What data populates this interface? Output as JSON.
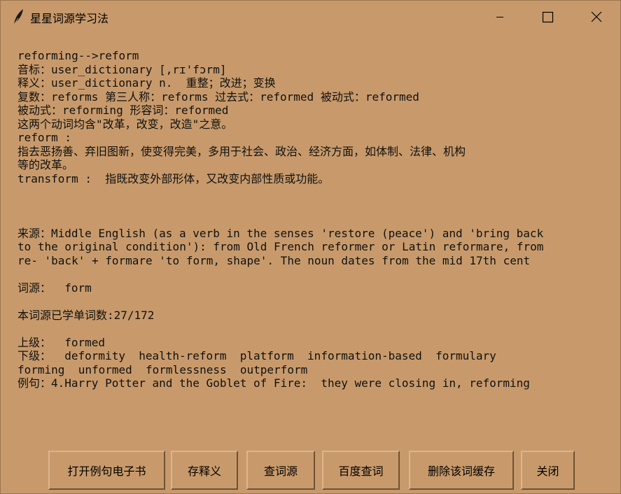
{
  "window": {
    "title": "星星词源学习法"
  },
  "content": {
    "lines": [
      "reforming-->reform",
      "音标：user_dictionary [,rɪ'fɔrm]",
      "释义：user_dictionary n.  重整；改进；变换",
      "复数：reforms 第三人称：reforms 过去式：reformed 被动式：reformed",
      "被动式：reforming 形容词：reformed",
      "这两个动词均含\"改革，改变，改造\"之意。",
      "reform :",
      "指去恶扬善、弃旧图新，使变得完美，多用于社会、政治、经济方面，如体制、法律、机构",
      "等的改革。",
      "transform :  指既改变外部形体，又改变内部性质或功能。",
      "",
      "",
      "",
      "来源：Middle English (as a verb in the senses 'restore (peace') and 'bring back",
      "to the original condition'): from Old French reformer or Latin reformare, from",
      "re- 'back' + formare 'to form, shape'. The noun dates from the mid 17th cent",
      "",
      "词源：  form",
      "",
      "本词源已学单词数:27/172",
      "",
      "上级：  formed",
      "下级：  deformity  health-reform  platform  information-based  formulary",
      "forming  unformed  formlessness  outperform",
      "例句：4.Harry Potter and the Goblet of Fire:  they were closing in, reforming"
    ]
  },
  "buttons": {
    "open_ebook": "打开例句电子书",
    "save_meaning": "存释义",
    "lookup_etymology": "查词源",
    "baidu_lookup": "百度查词",
    "delete_cache": "删除该词缓存",
    "close": "关闭"
  }
}
